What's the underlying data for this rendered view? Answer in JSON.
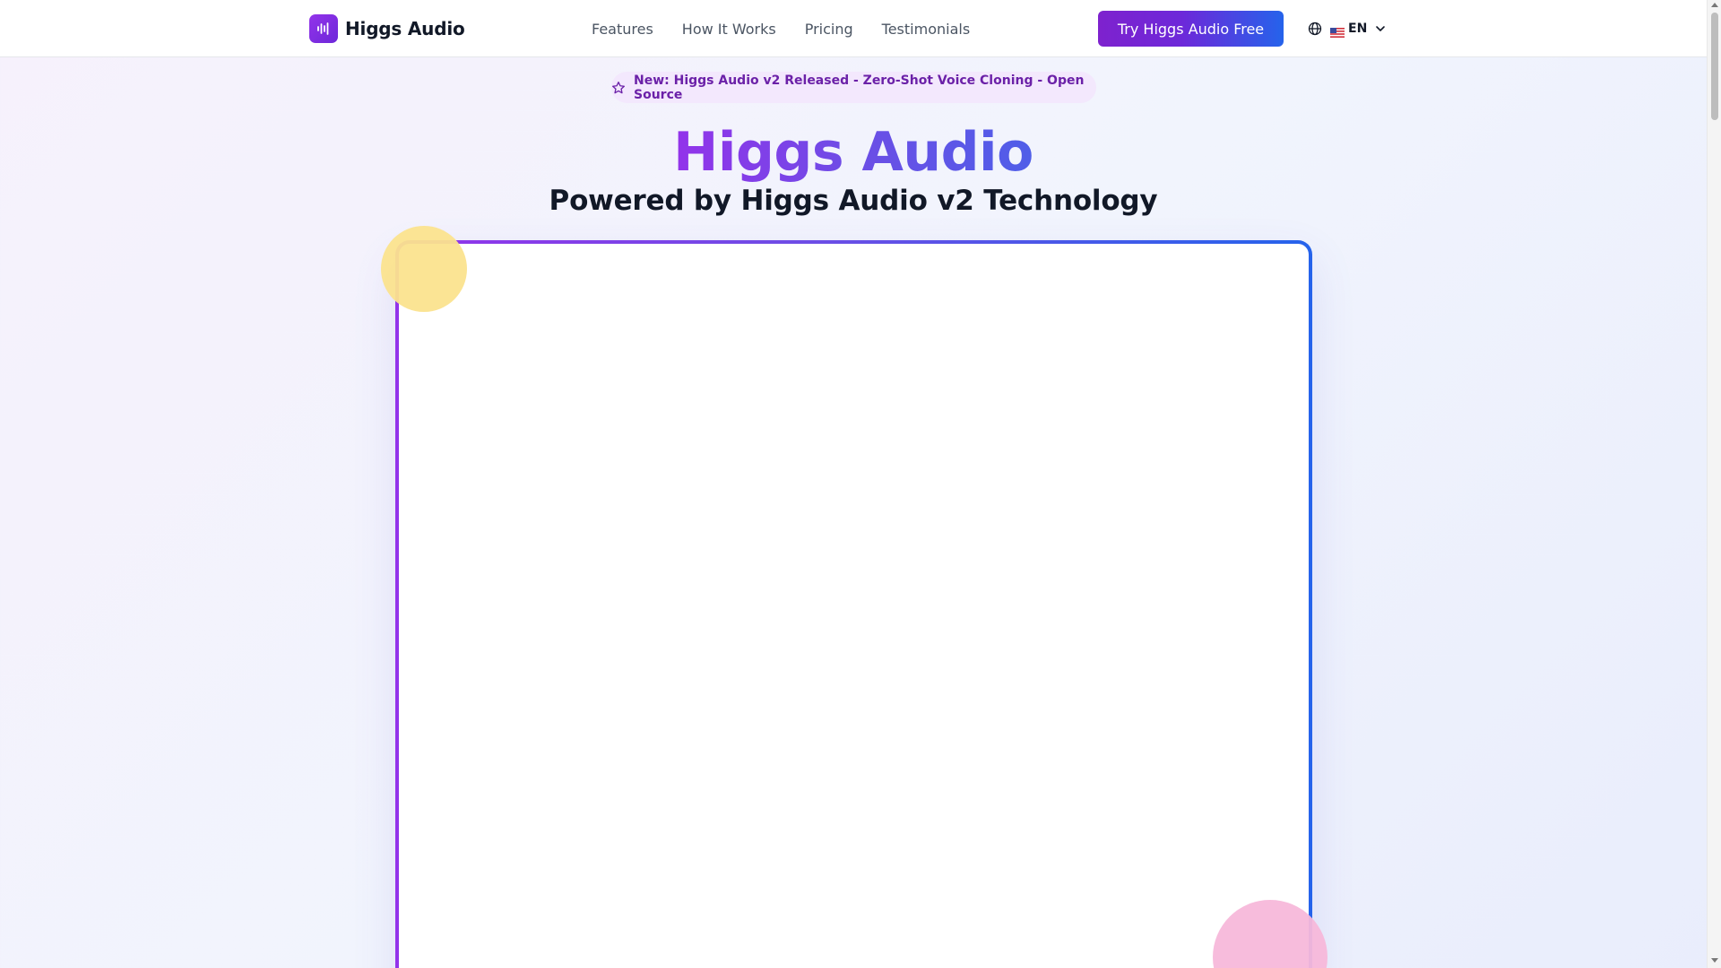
{
  "header": {
    "brand": "Higgs Audio",
    "logo_icon": "waveform-icon",
    "nav": [
      {
        "label": "Features"
      },
      {
        "label": "How It Works"
      },
      {
        "label": "Pricing"
      },
      {
        "label": "Testimonials"
      }
    ],
    "cta_label": "Try Higgs Audio Free",
    "language": {
      "globe_icon": "globe-icon",
      "flag": "us-flag",
      "code": "EN",
      "chevron": "chevron-down-icon"
    }
  },
  "hero": {
    "announcement": "New: Higgs Audio v2 Released - Zero-Shot Voice Cloning - Open Source",
    "announcement_icon": "star-icon",
    "title": "Higgs Audio",
    "subtitle": "Powered by Higgs Audio v2 Technology"
  },
  "colors": {
    "accent_purple": "#9333ea",
    "accent_blue": "#2563eb",
    "announcement_bg": "#f3e8fd",
    "announcement_text": "#6b21a8",
    "blob_yellow": "#fbe38e",
    "blob_pink": "#f7b8da"
  }
}
